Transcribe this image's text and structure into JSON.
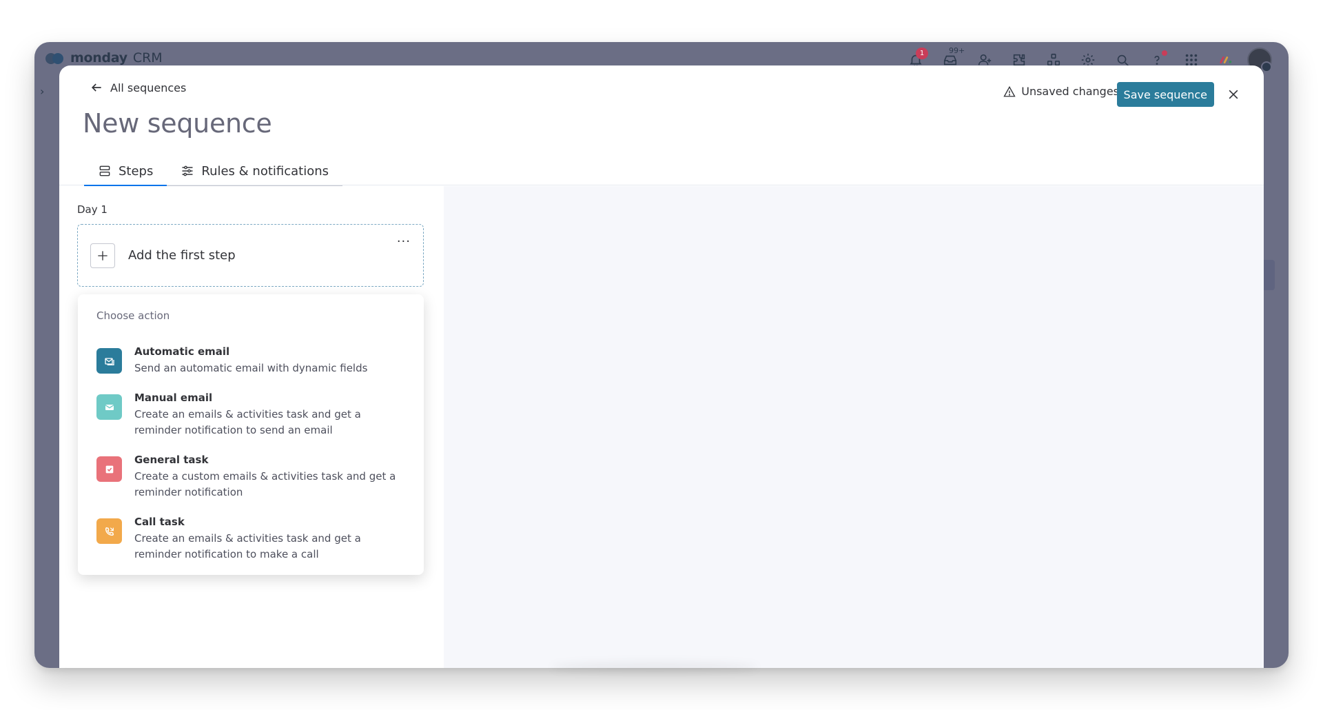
{
  "app": {
    "brand_name": "monday",
    "brand_suffix": "CRM",
    "notifications_badge": "1",
    "inbox_badge": "99+",
    "top_icons": [
      "bell-icon",
      "inbox-icon",
      "invite-icon",
      "integrations-icon",
      "apps-icon",
      "settings-icon",
      "search-icon",
      "help-icon",
      "grid-icon"
    ]
  },
  "modal": {
    "back_label": "All sequences",
    "title": "New sequence",
    "unsaved_label": "Unsaved changes",
    "save_label": "Save sequence",
    "tabs": [
      {
        "label": "Steps",
        "icon": "steps-icon",
        "active": true
      },
      {
        "label": "Rules & notifications",
        "icon": "sliders-icon",
        "active": false
      }
    ]
  },
  "steps": {
    "day_label": "Day 1",
    "add_step_label": "Add the first step",
    "more_label": "···"
  },
  "action_menu": {
    "heading": "Choose action",
    "items": [
      {
        "title": "Automatic email",
        "desc": "Send an automatic email with dynamic fields",
        "icon": "automatic-email-icon",
        "color": "#2b7c9b"
      },
      {
        "title": "Manual email",
        "desc": "Create an emails & activities task and get a reminder notification to send an email",
        "icon": "manual-email-icon",
        "color": "#6fcac6"
      },
      {
        "title": "General task",
        "desc": "Create a custom emails & activities task and get a reminder notification",
        "icon": "task-check-icon",
        "color": "#e9727a"
      },
      {
        "title": "Call task",
        "desc": "Create an emails & activities task and get a reminder notification to make a call",
        "icon": "phone-icon",
        "color": "#f2a94b"
      }
    ]
  }
}
